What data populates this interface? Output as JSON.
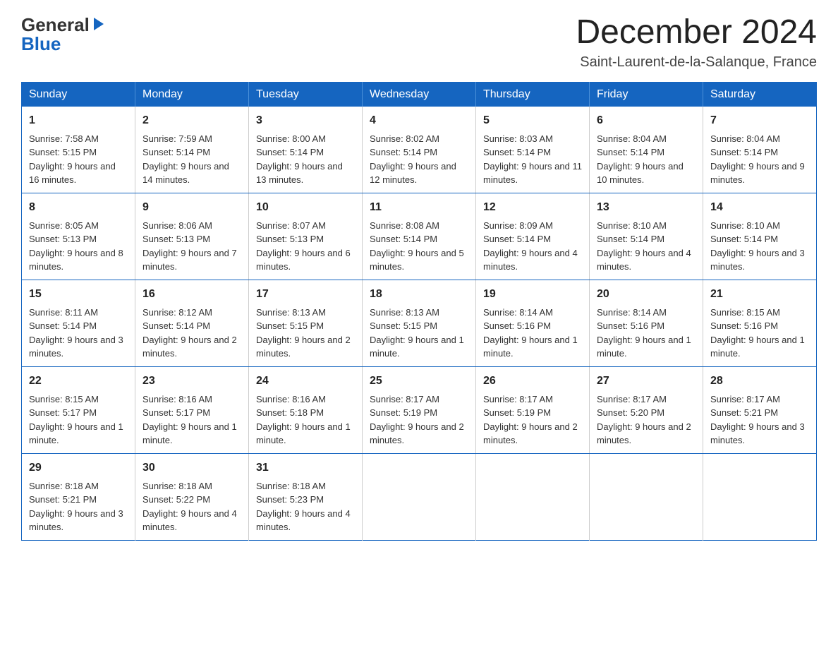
{
  "logo": {
    "line1": "General",
    "line2": "Blue",
    "arrow": "▶"
  },
  "header": {
    "title": "December 2024",
    "subtitle": "Saint-Laurent-de-la-Salanque, France"
  },
  "days_of_week": [
    "Sunday",
    "Monday",
    "Tuesday",
    "Wednesday",
    "Thursday",
    "Friday",
    "Saturday"
  ],
  "weeks": [
    [
      {
        "num": "1",
        "sunrise": "7:58 AM",
        "sunset": "5:15 PM",
        "daylight": "9 hours and 16 minutes."
      },
      {
        "num": "2",
        "sunrise": "7:59 AM",
        "sunset": "5:14 PM",
        "daylight": "9 hours and 14 minutes."
      },
      {
        "num": "3",
        "sunrise": "8:00 AM",
        "sunset": "5:14 PM",
        "daylight": "9 hours and 13 minutes."
      },
      {
        "num": "4",
        "sunrise": "8:02 AM",
        "sunset": "5:14 PM",
        "daylight": "9 hours and 12 minutes."
      },
      {
        "num": "5",
        "sunrise": "8:03 AM",
        "sunset": "5:14 PM",
        "daylight": "9 hours and 11 minutes."
      },
      {
        "num": "6",
        "sunrise": "8:04 AM",
        "sunset": "5:14 PM",
        "daylight": "9 hours and 10 minutes."
      },
      {
        "num": "7",
        "sunrise": "8:04 AM",
        "sunset": "5:14 PM",
        "daylight": "9 hours and 9 minutes."
      }
    ],
    [
      {
        "num": "8",
        "sunrise": "8:05 AM",
        "sunset": "5:13 PM",
        "daylight": "9 hours and 8 minutes."
      },
      {
        "num": "9",
        "sunrise": "8:06 AM",
        "sunset": "5:13 PM",
        "daylight": "9 hours and 7 minutes."
      },
      {
        "num": "10",
        "sunrise": "8:07 AM",
        "sunset": "5:13 PM",
        "daylight": "9 hours and 6 minutes."
      },
      {
        "num": "11",
        "sunrise": "8:08 AM",
        "sunset": "5:14 PM",
        "daylight": "9 hours and 5 minutes."
      },
      {
        "num": "12",
        "sunrise": "8:09 AM",
        "sunset": "5:14 PM",
        "daylight": "9 hours and 4 minutes."
      },
      {
        "num": "13",
        "sunrise": "8:10 AM",
        "sunset": "5:14 PM",
        "daylight": "9 hours and 4 minutes."
      },
      {
        "num": "14",
        "sunrise": "8:10 AM",
        "sunset": "5:14 PM",
        "daylight": "9 hours and 3 minutes."
      }
    ],
    [
      {
        "num": "15",
        "sunrise": "8:11 AM",
        "sunset": "5:14 PM",
        "daylight": "9 hours and 3 minutes."
      },
      {
        "num": "16",
        "sunrise": "8:12 AM",
        "sunset": "5:14 PM",
        "daylight": "9 hours and 2 minutes."
      },
      {
        "num": "17",
        "sunrise": "8:13 AM",
        "sunset": "5:15 PM",
        "daylight": "9 hours and 2 minutes."
      },
      {
        "num": "18",
        "sunrise": "8:13 AM",
        "sunset": "5:15 PM",
        "daylight": "9 hours and 1 minute."
      },
      {
        "num": "19",
        "sunrise": "8:14 AM",
        "sunset": "5:16 PM",
        "daylight": "9 hours and 1 minute."
      },
      {
        "num": "20",
        "sunrise": "8:14 AM",
        "sunset": "5:16 PM",
        "daylight": "9 hours and 1 minute."
      },
      {
        "num": "21",
        "sunrise": "8:15 AM",
        "sunset": "5:16 PM",
        "daylight": "9 hours and 1 minute."
      }
    ],
    [
      {
        "num": "22",
        "sunrise": "8:15 AM",
        "sunset": "5:17 PM",
        "daylight": "9 hours and 1 minute."
      },
      {
        "num": "23",
        "sunrise": "8:16 AM",
        "sunset": "5:17 PM",
        "daylight": "9 hours and 1 minute."
      },
      {
        "num": "24",
        "sunrise": "8:16 AM",
        "sunset": "5:18 PM",
        "daylight": "9 hours and 1 minute."
      },
      {
        "num": "25",
        "sunrise": "8:17 AM",
        "sunset": "5:19 PM",
        "daylight": "9 hours and 2 minutes."
      },
      {
        "num": "26",
        "sunrise": "8:17 AM",
        "sunset": "5:19 PM",
        "daylight": "9 hours and 2 minutes."
      },
      {
        "num": "27",
        "sunrise": "8:17 AM",
        "sunset": "5:20 PM",
        "daylight": "9 hours and 2 minutes."
      },
      {
        "num": "28",
        "sunrise": "8:17 AM",
        "sunset": "5:21 PM",
        "daylight": "9 hours and 3 minutes."
      }
    ],
    [
      {
        "num": "29",
        "sunrise": "8:18 AM",
        "sunset": "5:21 PM",
        "daylight": "9 hours and 3 minutes."
      },
      {
        "num": "30",
        "sunrise": "8:18 AM",
        "sunset": "5:22 PM",
        "daylight": "9 hours and 4 minutes."
      },
      {
        "num": "31",
        "sunrise": "8:18 AM",
        "sunset": "5:23 PM",
        "daylight": "9 hours and 4 minutes."
      },
      null,
      null,
      null,
      null
    ]
  ],
  "labels": {
    "sunrise": "Sunrise:",
    "sunset": "Sunset:",
    "daylight": "Daylight:"
  }
}
